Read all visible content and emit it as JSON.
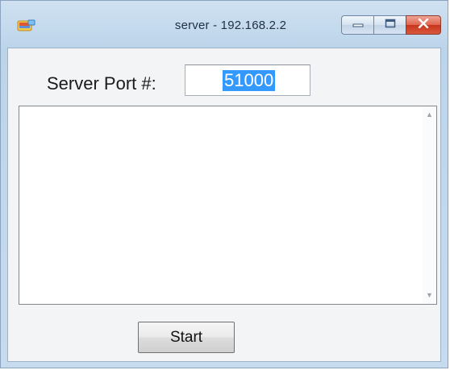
{
  "window": {
    "title": "server - 192.168.2.2",
    "controls": {
      "minimize_icon": "minimize-icon",
      "maximize_icon": "maximize-icon",
      "close_icon": "close-icon"
    }
  },
  "form": {
    "port_label": "Server Port #:",
    "port_value": "51000",
    "log_text": "",
    "start_label": "Start"
  },
  "colors": {
    "selection": "#3399ff",
    "close_button": "#d9583d",
    "frame": "#bcd4ea"
  }
}
